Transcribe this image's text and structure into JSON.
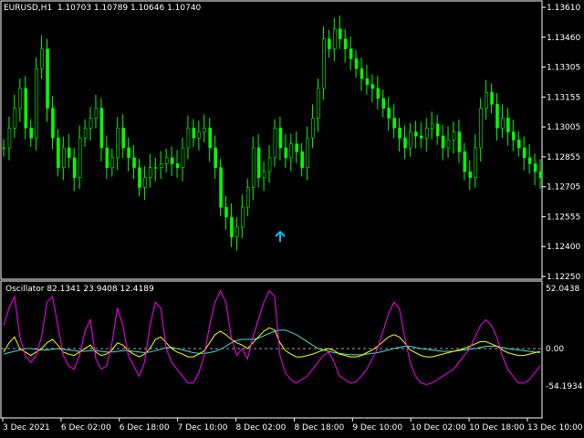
{
  "main": {
    "info_label": "EURUSD,H1  1.10703 1.10789 1.10646 1.10740",
    "price_ticks": [
      "1.13610",
      "1.13460",
      "1.13305",
      "1.13155",
      "1.13005",
      "1.12855",
      "1.12705",
      "1.12555",
      "1.12400",
      "1.12250"
    ],
    "arrow_signal": {
      "type": "up",
      "color": "#00BFFF",
      "x_label": "8 Dec 02:00",
      "price": 1.1245
    }
  },
  "oscillator": {
    "info_label": "Oscillator 82.1341 23.9408 12.4189",
    "ticks": [
      "52.0438",
      "0.00",
      "-54.1934"
    ],
    "zero_value": 0.0
  },
  "time_axis": {
    "labels": [
      "3 Dec 2021",
      "6 Dec 02:00",
      "6 Dec 18:00",
      "7 Dec 10:00",
      "8 Dec 02:00",
      "8 Dec 18:00",
      "9 Dec 10:00",
      "10 Dec 02:00",
      "10 Dec 18:00",
      "13 Dec 10:00"
    ]
  },
  "colors": {
    "background": "#000000",
    "candles": "#00FF00",
    "line_magenta": "#FF00FF",
    "line_yellow": "#FFFF00",
    "line_cyan": "#40E0D0",
    "zero_line": "#A0A0A0",
    "frame": "#FFFFFF"
  },
  "chart_data": {
    "type": "line",
    "price_closes": [
      1.129,
      1.13,
      1.131,
      1.132,
      1.13,
      1.1295,
      1.133,
      1.134,
      1.131,
      1.1295,
      1.128,
      1.129,
      1.1285,
      1.1275,
      1.1295,
      1.13,
      1.1305,
      1.131,
      1.129,
      1.128,
      1.1285,
      1.13,
      1.129,
      1.1285,
      1.128,
      1.127,
      1.1275,
      1.128,
      1.128,
      1.1282,
      1.1285,
      1.1282,
      1.128,
      1.129,
      1.13,
      1.1295,
      1.1298,
      1.13,
      1.129,
      1.128,
      1.126,
      1.1255,
      1.1245,
      1.125,
      1.126,
      1.127,
      1.129,
      1.1275,
      1.1278,
      1.1285,
      1.13,
      1.129,
      1.1285,
      1.1292,
      1.1288,
      1.128,
      1.1295,
      1.1305,
      1.132,
      1.1345,
      1.134,
      1.135,
      1.1345,
      1.134,
      1.1335,
      1.133,
      1.1325,
      1.1322,
      1.132,
      1.1315,
      1.131,
      1.1305,
      1.13,
      1.1295,
      1.129,
      1.1298,
      1.1296,
      1.1295,
      1.13,
      1.1302,
      1.1296,
      1.129,
      1.1294,
      1.1298,
      1.1288,
      1.1278,
      1.1275,
      1.129,
      1.131,
      1.1318,
      1.1312,
      1.13,
      1.1305,
      1.1298,
      1.1294,
      1.129,
      1.1285,
      1.1282,
      1.1278,
      1.1275
    ],
    "osc_magenta": [
      20,
      35,
      45,
      10,
      -10,
      -20,
      -10,
      10,
      40,
      45,
      20,
      -10,
      -25,
      -30,
      -10,
      15,
      25,
      -15,
      -30,
      -25,
      5,
      35,
      20,
      -10,
      -25,
      -40,
      -20,
      20,
      40,
      35,
      0,
      -20,
      -30,
      -40,
      -50,
      -50,
      -35,
      -10,
      20,
      40,
      50,
      40,
      10,
      -10,
      0,
      -15,
      10,
      25,
      40,
      50,
      45,
      -10,
      -35,
      -45,
      -50,
      -45,
      -40,
      -30,
      -20,
      -10,
      -5,
      -20,
      -40,
      -45,
      -50,
      -48,
      -40,
      -30,
      -15,
      0,
      15,
      30,
      40,
      35,
      10,
      -20,
      -40,
      -50,
      -52,
      -50,
      -45,
      -40,
      -35,
      -30,
      -20,
      -10,
      0,
      10,
      20,
      25,
      20,
      10,
      -10,
      -30,
      -40,
      -50,
      -50,
      -45,
      -35,
      -25
    ],
    "osc_yellow": [
      -5,
      5,
      10,
      0,
      -5,
      -10,
      -5,
      0,
      5,
      8,
      3,
      -5,
      -8,
      -10,
      -5,
      0,
      3,
      -5,
      -10,
      -8,
      -2,
      5,
      3,
      -3,
      -8,
      -12,
      -8,
      0,
      8,
      10,
      5,
      0,
      -5,
      -8,
      -12,
      -12,
      -8,
      -3,
      5,
      12,
      15,
      12,
      8,
      5,
      3,
      0,
      5,
      10,
      15,
      18,
      16,
      5,
      -3,
      -8,
      -12,
      -12,
      -10,
      -8,
      -5,
      -2,
      0,
      -3,
      -8,
      -10,
      -12,
      -12,
      -10,
      -6,
      -2,
      2,
      6,
      10,
      12,
      10,
      5,
      -2,
      -6,
      -10,
      -12,
      -12,
      -10,
      -8,
      -6,
      -4,
      -2,
      0,
      2,
      4,
      6,
      6,
      4,
      2,
      -2,
      -6,
      -8,
      -10,
      -10,
      -8,
      -6,
      -4
    ],
    "osc_cyan": [
      -8,
      -6,
      -4,
      -2,
      0,
      0,
      -1,
      -2,
      -2,
      -1,
      0,
      -1,
      -2,
      -3,
      -4,
      -4,
      -3,
      -3,
      -4,
      -5,
      -5,
      -4,
      -3,
      -3,
      -4,
      -5,
      -6,
      -5,
      -3,
      -1,
      1,
      1,
      0,
      -2,
      -4,
      -6,
      -7,
      -7,
      -6,
      -4,
      -1,
      2,
      5,
      7,
      8,
      8,
      8,
      9,
      11,
      13,
      15,
      16,
      16,
      14,
      12,
      9,
      6,
      3,
      0,
      -2,
      -4,
      -6,
      -7,
      -8,
      -9,
      -9,
      -9,
      -8,
      -7,
      -6,
      -4,
      -2,
      0,
      1,
      2,
      2,
      1,
      0,
      -1,
      -2,
      -3,
      -4,
      -4,
      -4,
      -3,
      -2,
      -1,
      0,
      1,
      2,
      2,
      2,
      1,
      0,
      -1,
      -2,
      -3,
      -4,
      -5,
      -6
    ]
  }
}
